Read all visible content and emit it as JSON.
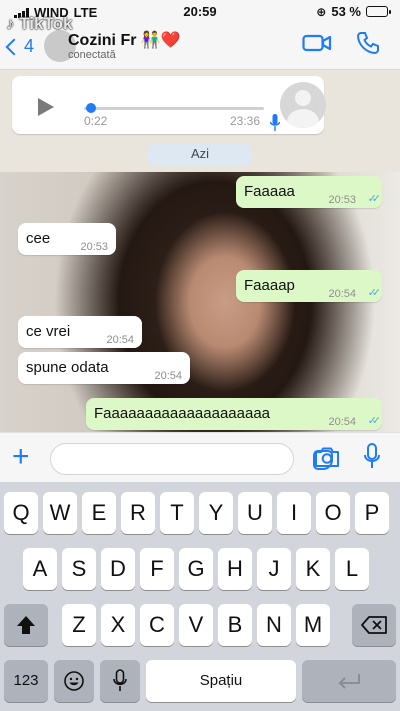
{
  "status_bar": {
    "carrier": "WIND",
    "network": "LTE",
    "time": "20:59",
    "battery": "53 %",
    "battery_level": 0.53
  },
  "watermark": {
    "brand": "TikTok",
    "handle": "@..."
  },
  "header": {
    "back_count": "4",
    "contact_name": "Cozini Fr",
    "contact_emoji": "👫❤️",
    "subtitle": "conectată",
    "accent_color": "#1f7bf6"
  },
  "voice_message": {
    "elapsed": "0:22",
    "timestamp": "23:36",
    "progress": 0.02
  },
  "date_separator": "Azi",
  "messages": [
    {
      "direction": "out",
      "text": "Faaaaa",
      "time": "20:53",
      "read": true
    },
    {
      "direction": "in",
      "text": "cee",
      "time": "20:53"
    },
    {
      "direction": "out",
      "text": "Faaaap",
      "time": "20:54",
      "read": true
    },
    {
      "direction": "in",
      "text": "ce vrei",
      "time": "20:54"
    },
    {
      "direction": "in",
      "text": "spune odata",
      "time": "20:54"
    },
    {
      "direction": "out",
      "text": "Faaaaaaaaaaaaaaaaaaaa",
      "time": "20:54",
      "read": true
    }
  ],
  "keyboard": {
    "row1": [
      "Q",
      "W",
      "E",
      "R",
      "T",
      "Y",
      "U",
      "I",
      "O",
      "P"
    ],
    "row2": [
      "A",
      "S",
      "D",
      "F",
      "G",
      "H",
      "J",
      "K",
      "L"
    ],
    "row3": [
      "Z",
      "X",
      "C",
      "V",
      "B",
      "N",
      "M"
    ],
    "numbers_key": "123",
    "space_key": "Spațiu"
  }
}
